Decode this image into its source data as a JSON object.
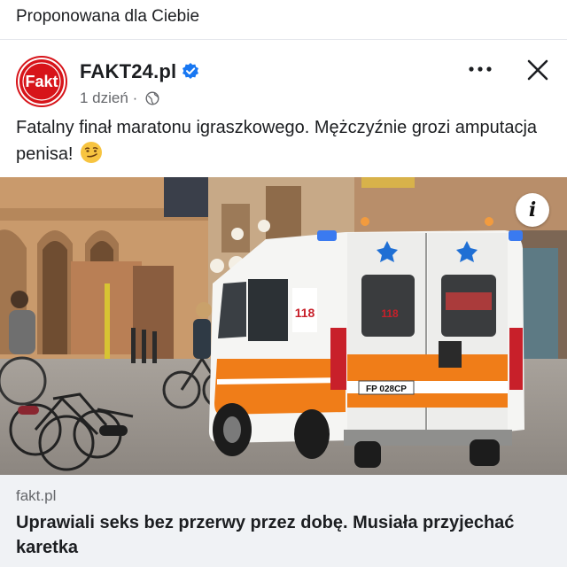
{
  "topbar": {
    "title": "Proponowana dla Ciebie"
  },
  "post": {
    "page_name": "FAKT24.pl",
    "avatar_text": "Fakt",
    "timestamp": "1 dzień",
    "separator": "·",
    "text": "Fatalny finał maratonu igraszkowego. Mężczyźnie grozi amputacja penisa!",
    "emoji": "smirking-face-emoji",
    "info_label": "i"
  },
  "photo": {
    "plate": "FP 028CP",
    "ambulance_logo": "118"
  },
  "link": {
    "domain": "fakt.pl",
    "title": "Uprawiali seks bez przerwy przez dobę. Musiała przyjechać karetka"
  },
  "icons": {
    "more": "more-horizontal-icon",
    "close": "close-icon",
    "verified": "verified-badge-icon",
    "audience": "globe-icon"
  },
  "colors": {
    "brand_red": "#d7141a",
    "verified_blue": "#1877f2",
    "ambulance_orange": "#f07d18",
    "text_secondary": "#65676b",
    "card_bg": "#f0f2f5"
  }
}
